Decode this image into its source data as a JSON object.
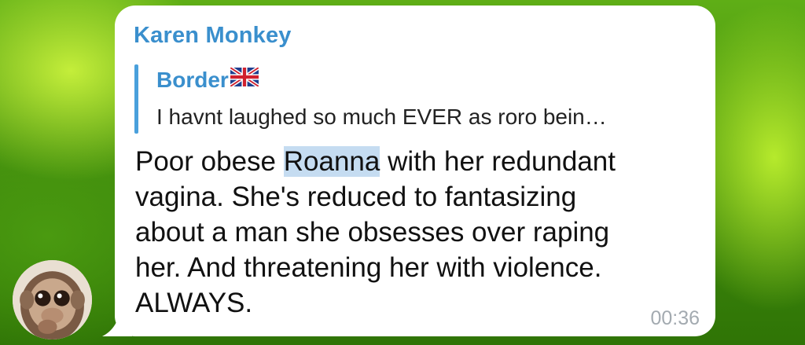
{
  "chat": {
    "sender_name": "Karen Monkey",
    "reply": {
      "author": "Border",
      "flag_icon": "uk-flag-icon",
      "preview": "I havnt laughed so much EVER as roro bein…"
    },
    "message": {
      "line1_before": "Poor obese ",
      "line1_highlight": "Roanna",
      "line1_after": " with her redundant",
      "line2": "vagina. She's reduced to fantasizing",
      "line3": "about a man she obsesses over raping",
      "line4": "her. And threatening her with violence.",
      "line5": "ALWAYS."
    },
    "time": "00:36",
    "colors": {
      "name_blue": "#3a8fcd",
      "highlight": "#c5dcf1",
      "bubble": "#ffffff",
      "background_green": "#5fae16"
    }
  },
  "avatar": {
    "icon": "monkey-avatar-icon"
  }
}
